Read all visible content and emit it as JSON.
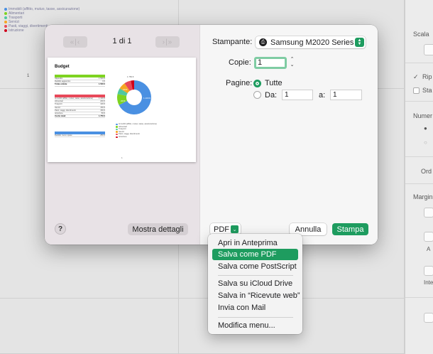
{
  "background": {
    "legend": [
      {
        "label": "Immobili (affitto, mutuo, tasse, assicurazione)",
        "color": "#4a90e2"
      },
      {
        "label": "Alimentari",
        "color": "#7ed321"
      },
      {
        "label": "Trasporti",
        "color": "#50c8a0"
      },
      {
        "label": "Servizi",
        "color": "#f5a623"
      },
      {
        "label": "Pasti, viaggi, divertimenti",
        "color": "#e8495a"
      },
      {
        "label": "Istruzione",
        "color": "#d0021b"
      }
    ],
    "page_number": "1",
    "side_panel": {
      "scale_label": "Scala",
      "repeat_label": "Rip",
      "print_label": "Sta",
      "numbering_label": "Numer",
      "order_label": "Ord",
      "margins_label": "Margin",
      "a_label": "A",
      "interval_label": "Inte"
    }
  },
  "dialog": {
    "page_indicator": "1 di 1",
    "prev_label": "«|‹",
    "next_label": "›|»",
    "preview": {
      "title": "Budget",
      "income_rows": [
        [
          "Stipendio",
          "1.500 €"
        ],
        [
          "Reddito aggiuntivo",
          "0 €"
        ],
        [
          "Totale entrate",
          "1.500 €"
        ]
      ],
      "expense_rows": [
        [
          "Immobili (affitto, mutuo, tasse, assicurazione)",
          "1.100 €"
        ],
        [
          "Alimentari",
          "200 €"
        ],
        [
          "Trasporti",
          "100 €"
        ],
        [
          "Servizi",
          "150 €"
        ],
        [
          "Pasti, viaggi, divertimenti",
          "150 €"
        ],
        [
          "Istruzione",
          "50 €"
        ],
        [
          "Uscite totali",
          "1.750 €"
        ]
      ],
      "balance_rows": [
        [
          "Reddito meno spese",
          "-250 €"
        ]
      ],
      "chart_label": "1.750 €",
      "pie_labels": [
        "1.100 €",
        "200 €",
        "150 €"
      ],
      "page_number": "1"
    },
    "help_label": "?",
    "details_label": "Mostra dettagli",
    "printer_label": "Stampante:",
    "printer_value": "Samsung M2020 Series",
    "copies_label": "Copie:",
    "copies_value": "1",
    "pages_label": "Pagine:",
    "pages_all_label": "Tutte",
    "pages_from_label": "Da:",
    "pages_from_value": "1",
    "pages_to_label": "a:",
    "pages_to_value": "1",
    "pdf_label": "PDF",
    "cancel_label": "Annulla",
    "print_label": "Stampa",
    "accent_color": "#1e9c5f"
  },
  "menu": {
    "items": [
      "Apri in Anteprima",
      "Salva come PDF",
      "Salva come PostScript",
      "Salva su iCloud Drive",
      "Salva in “Ricevute web”",
      "Invia con Mail",
      "Modifica menu..."
    ],
    "active_index": 1
  }
}
